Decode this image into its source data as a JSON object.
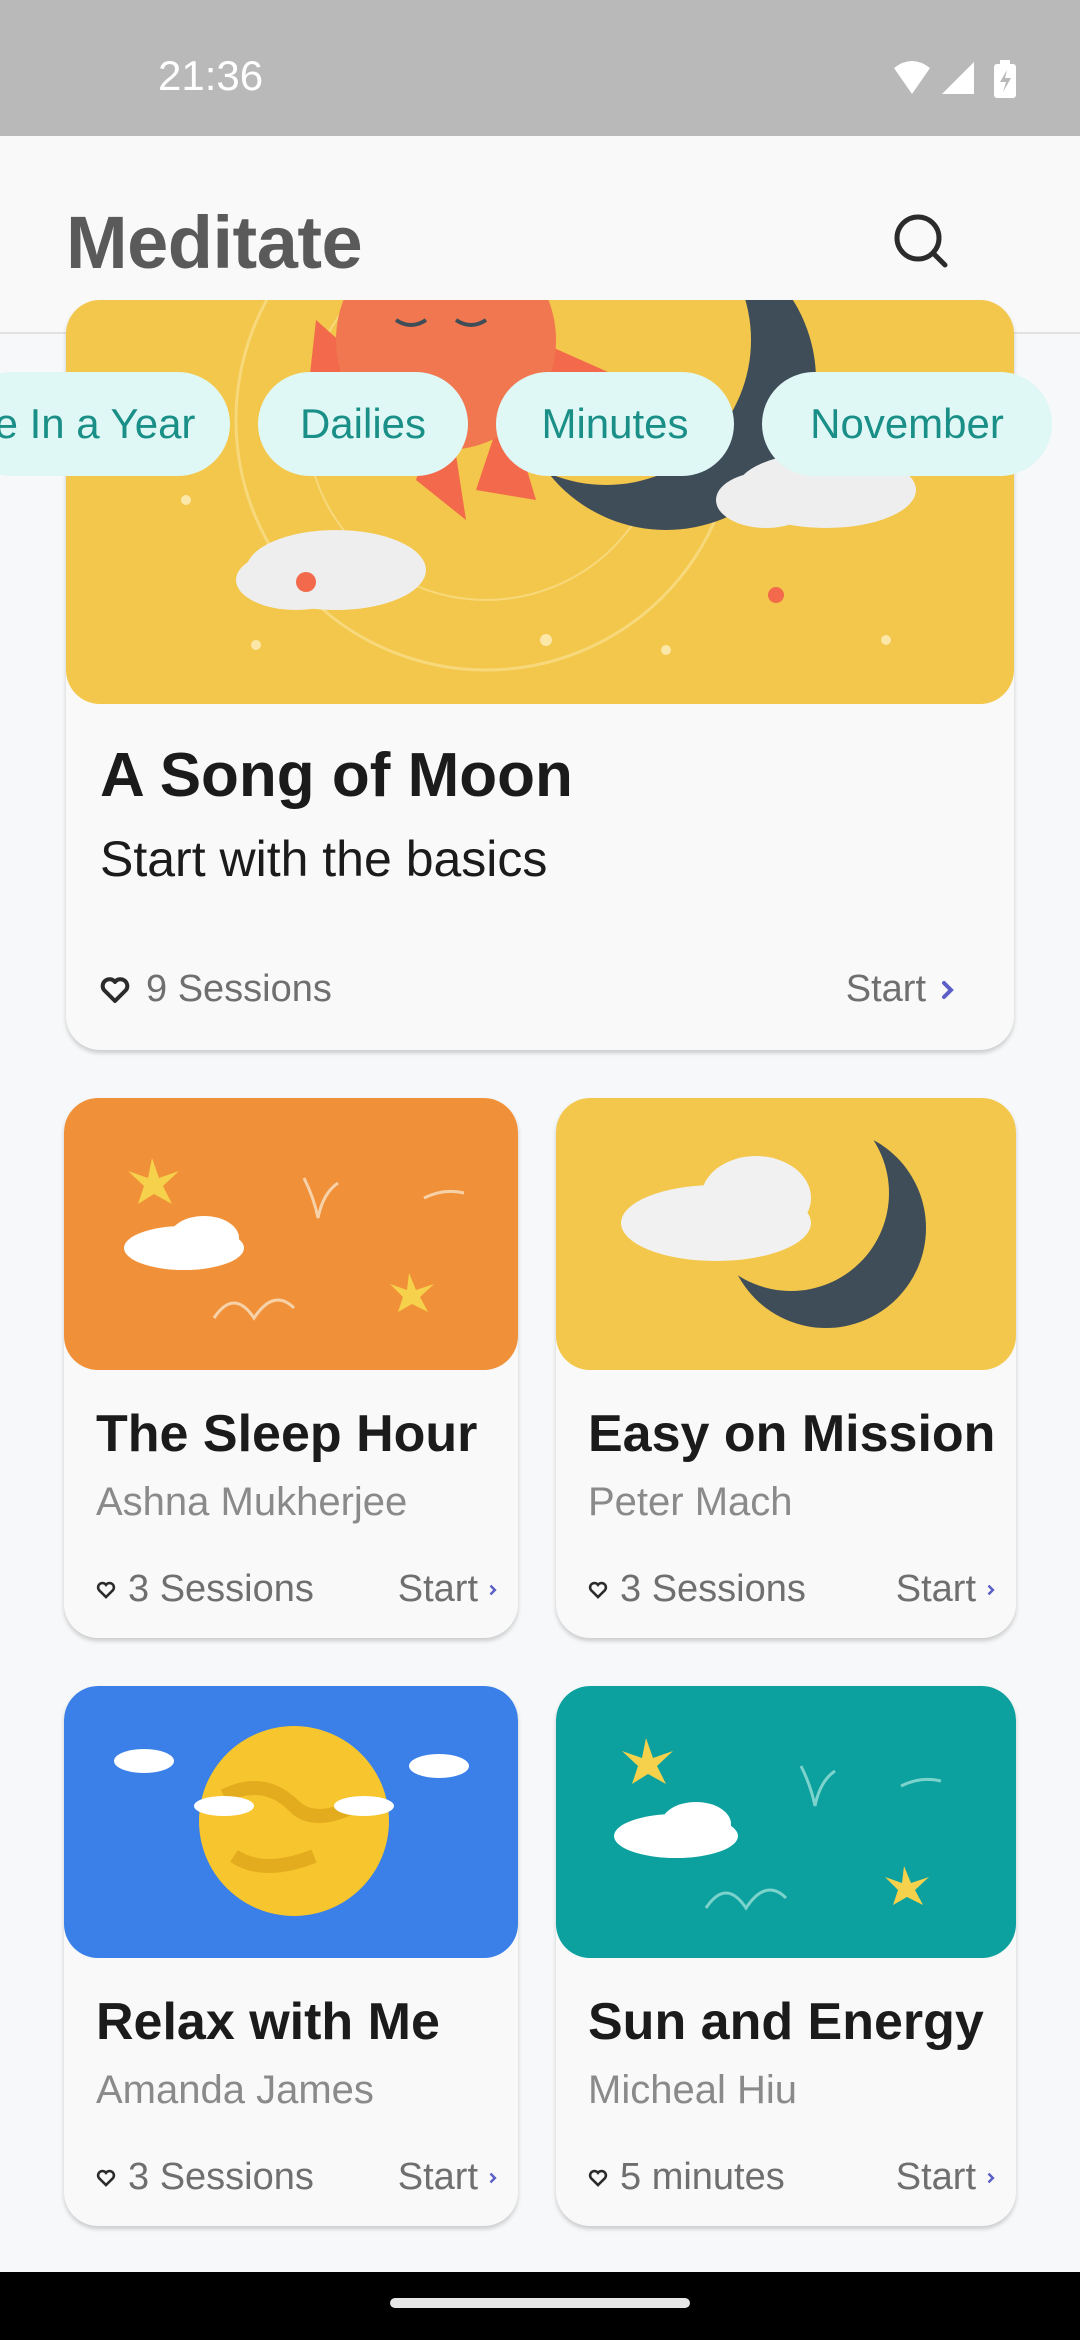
{
  "status_bar": {
    "time": "21:36",
    "icons": [
      "wifi-icon",
      "signal-icon",
      "battery-icon"
    ]
  },
  "app_bar": {
    "title": "Meditate",
    "search_icon": "search-icon"
  },
  "chips": [
    "e In a Year",
    "Dailies",
    "Minutes",
    "November"
  ],
  "featured": {
    "title": "A Song of Moon",
    "subtitle": "Start with the basics",
    "sessions": "9 Sessions",
    "start": "Start"
  },
  "cards": [
    {
      "title": "The Sleep Hour",
      "author": "Ashna Mukherjee",
      "sessions": "3 Sessions",
      "start": "Start",
      "art_color": "#f0913a"
    },
    {
      "title": "Easy on Mission",
      "author": "Peter Mach",
      "sessions": "3 Sessions",
      "start": "Start",
      "art_color": "#f3c74b"
    },
    {
      "title": "Relax with Me",
      "author": "Amanda James",
      "sessions": "3 Sessions",
      "start": "Start",
      "art_color": "#3a80e8"
    },
    {
      "title": "Sun and Energy",
      "author": "Micheal Hiu",
      "sessions": "5 minutes",
      "start": "Start",
      "art_color": "#0ca09f"
    }
  ],
  "colors": {
    "chip_bg": "#dff8f6",
    "chip_text": "#1a8f87",
    "accent_chevron": "#5b5fc7"
  }
}
